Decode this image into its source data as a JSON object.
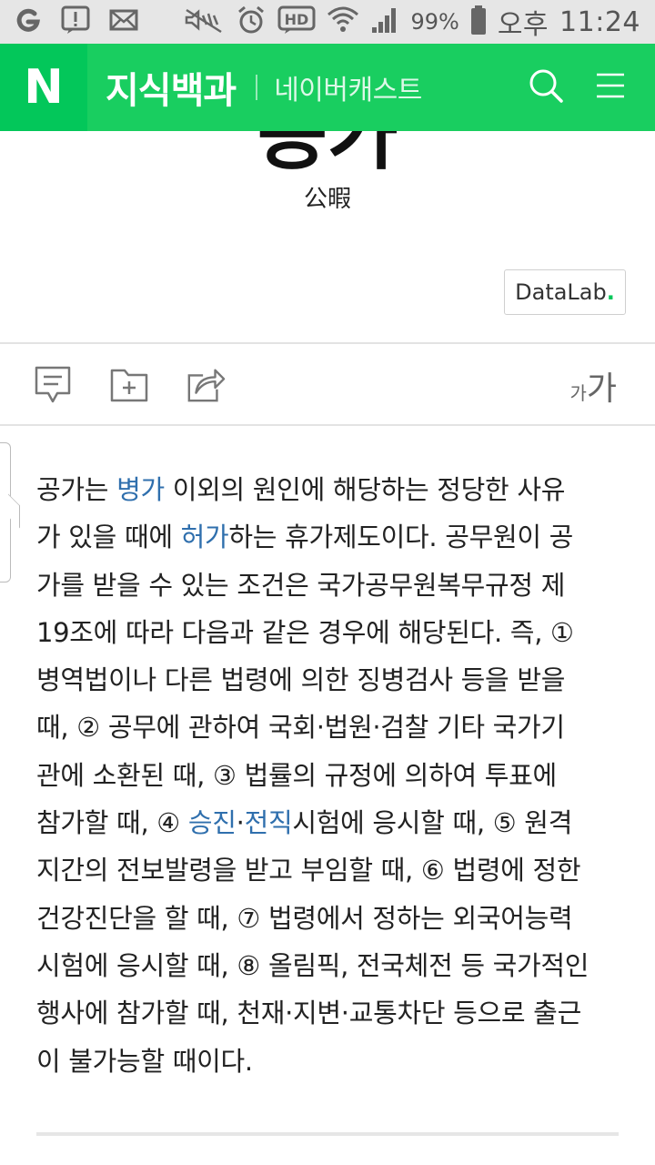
{
  "status_bar": {
    "battery": "99%",
    "ampm": "오후",
    "time": "11:24"
  },
  "header": {
    "logo": "N",
    "title": "지식백과",
    "subtitle": "네이버캐스트"
  },
  "entry": {
    "title": "공가",
    "hanja": "公暇",
    "datalab_label": "DataLab",
    "datalab_dot": "."
  },
  "toolbar": {
    "font_small": "가",
    "font_big": "가"
  },
  "article": {
    "lines": [
      [
        {
          "t": "공가는 "
        },
        {
          "t": "병가",
          "link": true
        },
        {
          "t": " 이외의 원인에 해당하는 정당한 사유"
        }
      ],
      [
        {
          "t": "가 있을 때에 "
        },
        {
          "t": "허가",
          "link": true
        },
        {
          "t": "하는 휴가제도이다. 공무원이 공"
        }
      ],
      [
        {
          "t": "가를 받을 수 있는 조건은 국가공무원복무규정 제"
        }
      ],
      [
        {
          "t": "19조에 따라 다음과 같은 경우에 해당된다. 즉, ①"
        }
      ],
      [
        {
          "t": "병역법이나 다른 법령에 의한 징병검사 등을 받을"
        }
      ],
      [
        {
          "t": "때, ② 공무에 관하여 국회·법원·검찰 기타 국가기"
        }
      ],
      [
        {
          "t": "관에 소환된 때, ③ 법률의 규정에 의하여 투표에"
        }
      ],
      [
        {
          "t": "참가할 때, ④ "
        },
        {
          "t": "승진",
          "link": true
        },
        {
          "t": "·"
        },
        {
          "t": "전직",
          "link": true
        },
        {
          "t": "시험에 응시할 때, ⑤ 원격"
        }
      ],
      [
        {
          "t": "지간의 전보발령을 받고 부임할 때, ⑥ 법령에 정한"
        }
      ],
      [
        {
          "t": "건강진단을 할 때, ⑦ 법령에서 정하는 외국어능력"
        }
      ],
      [
        {
          "t": "시험에 응시할 때, ⑧ 올림픽, 전국체전 등 국가적인"
        }
      ],
      [
        {
          "t": "행사에 참가할 때, 천재·지변·교통차단 등으로 출근"
        }
      ],
      [
        {
          "t": "이 불가능할 때이다."
        }
      ]
    ]
  },
  "colors": {
    "brand_green": "#19ce60",
    "logo_green": "#03c75a",
    "link_blue": "#2f6fad"
  },
  "icons": [
    "g-icon",
    "alert-icon",
    "mail-icon",
    "mute-icon",
    "alarm-icon",
    "hd-icon",
    "wifi-icon",
    "signal-icon",
    "battery-icon",
    "search-icon",
    "menu-icon",
    "comment-icon",
    "add-folder-icon",
    "share-icon"
  ]
}
